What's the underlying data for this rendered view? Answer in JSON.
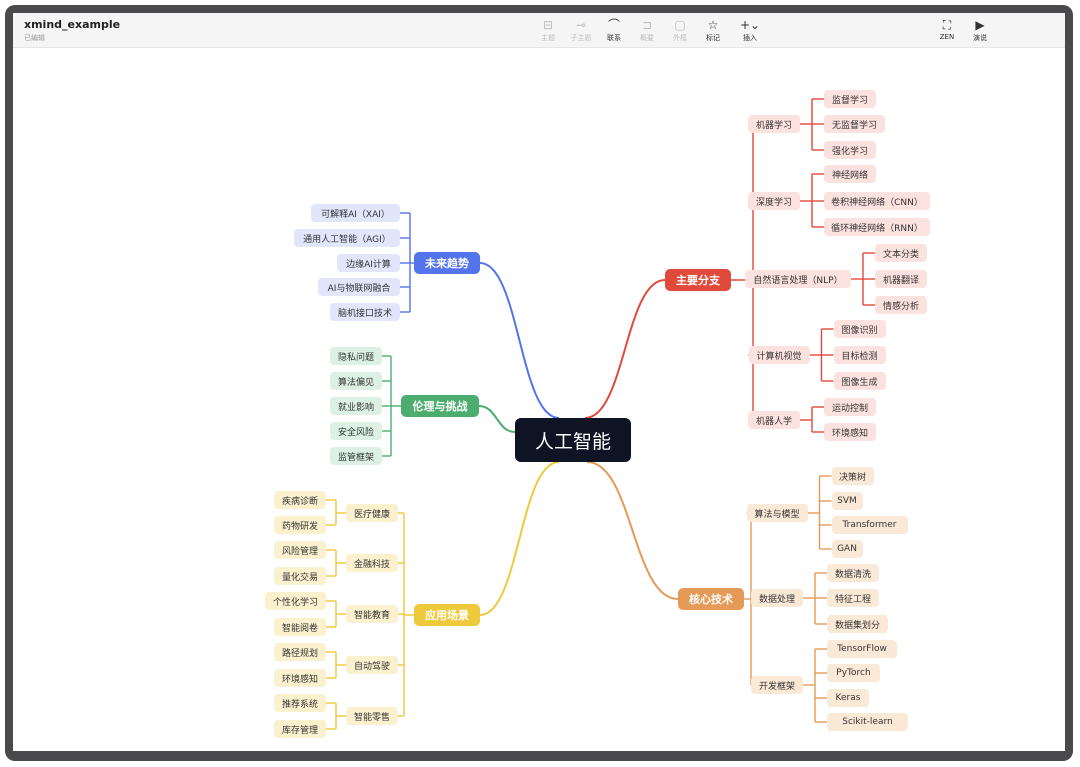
{
  "window": {
    "doc_title": "xmind_example",
    "doc_status": "已编辑"
  },
  "toolbar": {
    "topic": "主题",
    "subtopic": "子主题",
    "relation": "联系",
    "summary": "概要",
    "boundary": "外框",
    "marker": "标记",
    "insert": "插入",
    "zen": "ZEN",
    "present": "演说"
  },
  "mindmap": {
    "root": "人工智能",
    "colors": {
      "red": "#e04a3a",
      "orange": "#e59a57",
      "yellow": "#eec93b",
      "green": "#4cad6e",
      "blue": "#5374ea"
    },
    "main_branch": {
      "label": "主要分支",
      "l2": [
        "机器学习",
        "深度学习",
        "自然语言处理（NLP）",
        "计算机视觉",
        "机器人学"
      ],
      "ml": [
        "监督学习",
        "无监督学习",
        "强化学习"
      ],
      "dl": [
        "神经网络",
        "卷积神经网络（CNN）",
        "循环神经网络（RNN）"
      ],
      "nlp": [
        "文本分类",
        "机器翻译",
        "情感分析"
      ],
      "cv": [
        "图像识别",
        "目标检测",
        "图像生成"
      ],
      "robot": [
        "运动控制",
        "环境感知"
      ]
    },
    "core_tech": {
      "label": "核心技术",
      "l2": [
        "算法与模型",
        "数据处理",
        "开发框架"
      ],
      "algo": [
        "决策树",
        "SVM",
        "Transformer",
        "GAN"
      ],
      "data": [
        "数据清洗",
        "特征工程",
        "数据集划分"
      ],
      "fw": [
        "TensorFlow",
        "PyTorch",
        "Keras",
        "Scikit-learn"
      ]
    },
    "future": {
      "label": "未来趋势",
      "items": [
        "可解释AI（XAI）",
        "通用人工智能（AGI）",
        "边缘AI计算",
        "AI与物联网融合",
        "脑机接口技术"
      ]
    },
    "ethics": {
      "label": "伦理与挑战",
      "items": [
        "隐私问题",
        "算法偏见",
        "就业影响",
        "安全风险",
        "监管框架"
      ]
    },
    "apps": {
      "label": "应用场景",
      "l2": [
        "医疗健康",
        "金融科技",
        "智能教育",
        "自动驾驶",
        "智能零售"
      ],
      "health": [
        "疾病诊断",
        "药物研发"
      ],
      "fin": [
        "风险管理",
        "量化交易"
      ],
      "edu": [
        "个性化学习",
        "智能阅卷"
      ],
      "auto": [
        "路径规划",
        "环境感知"
      ],
      "retail": [
        "推荐系统",
        "库存管理"
      ]
    }
  }
}
